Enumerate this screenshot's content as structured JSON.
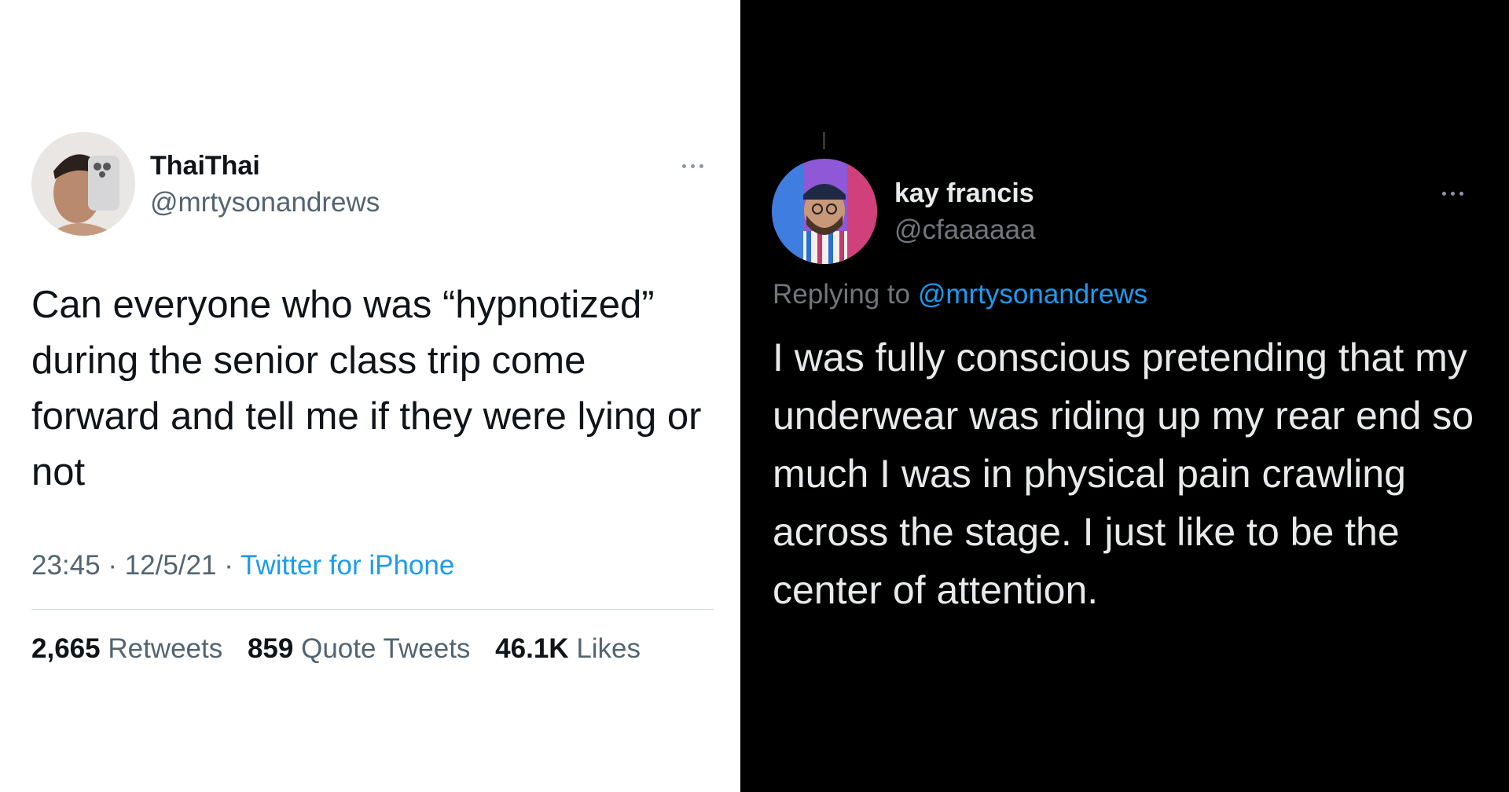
{
  "left_tweet": {
    "display_name": "ThaiThai",
    "handle": "@mrtysonandrews",
    "text": "Can everyone who was “hypnotized” during the senior class trip come forward and tell me if they were lying or not",
    "time": "23:45",
    "separator": "·",
    "date": "12/5/21",
    "source": "Twitter for iPhone",
    "stats": {
      "retweets_count": "2,665",
      "retweets_label": "Retweets",
      "quotes_count": "859",
      "quotes_label": "Quote Tweets",
      "likes_count": "46.1K",
      "likes_label": "Likes"
    }
  },
  "right_tweet": {
    "display_name": "kay francis",
    "handle": "@cfaaaaaa",
    "replying_prefix": "Replying to",
    "replying_handle": "@mrtysonandrews",
    "text": "I was fully conscious pretending that my underwear was riding up my rear end so much I was in physical pain crawling across the stage. I just like to be the center of attention."
  },
  "colors": {
    "link": "#1d9bf0",
    "light_bg": "#ffffff",
    "dark_bg": "#000000"
  },
  "icons": [
    "more-icon",
    "avatar"
  ]
}
